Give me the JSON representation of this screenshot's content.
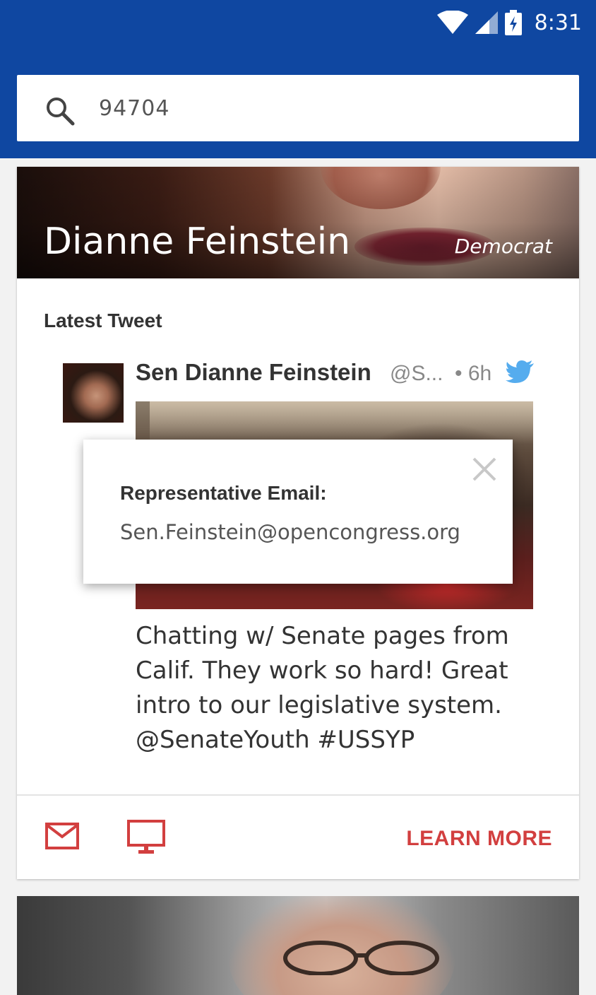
{
  "status_bar": {
    "time": "8:31",
    "icons": [
      "wifi-icon",
      "signal-icon",
      "battery-charging-icon"
    ]
  },
  "search": {
    "value": "94704",
    "icon": "search-icon"
  },
  "rep_card": {
    "name": "Dianne Feinstein",
    "party": "Democrat",
    "section_label": "Latest Tweet",
    "tweet": {
      "author": "Sen Dianne Feinstein",
      "handle": "@S...",
      "time": "• 6h",
      "text": "Chatting w/ Senate pages from Calif. They work so hard! Great intro to our legislative system. @SenateYouth #USSYP",
      "icon": "twitter-bird-icon"
    },
    "actions": {
      "email_icon": "mail-icon",
      "website_icon": "monitor-icon",
      "learn_more": "LEARN MORE"
    }
  },
  "popup": {
    "title": "Representative Email:",
    "email": "Sen.Feinstein@opencongress.org",
    "close_icon": "close-icon"
  },
  "colors": {
    "app_bar": "#0f47a1",
    "accent": "#d23f3f",
    "twitter": "#55acee"
  }
}
